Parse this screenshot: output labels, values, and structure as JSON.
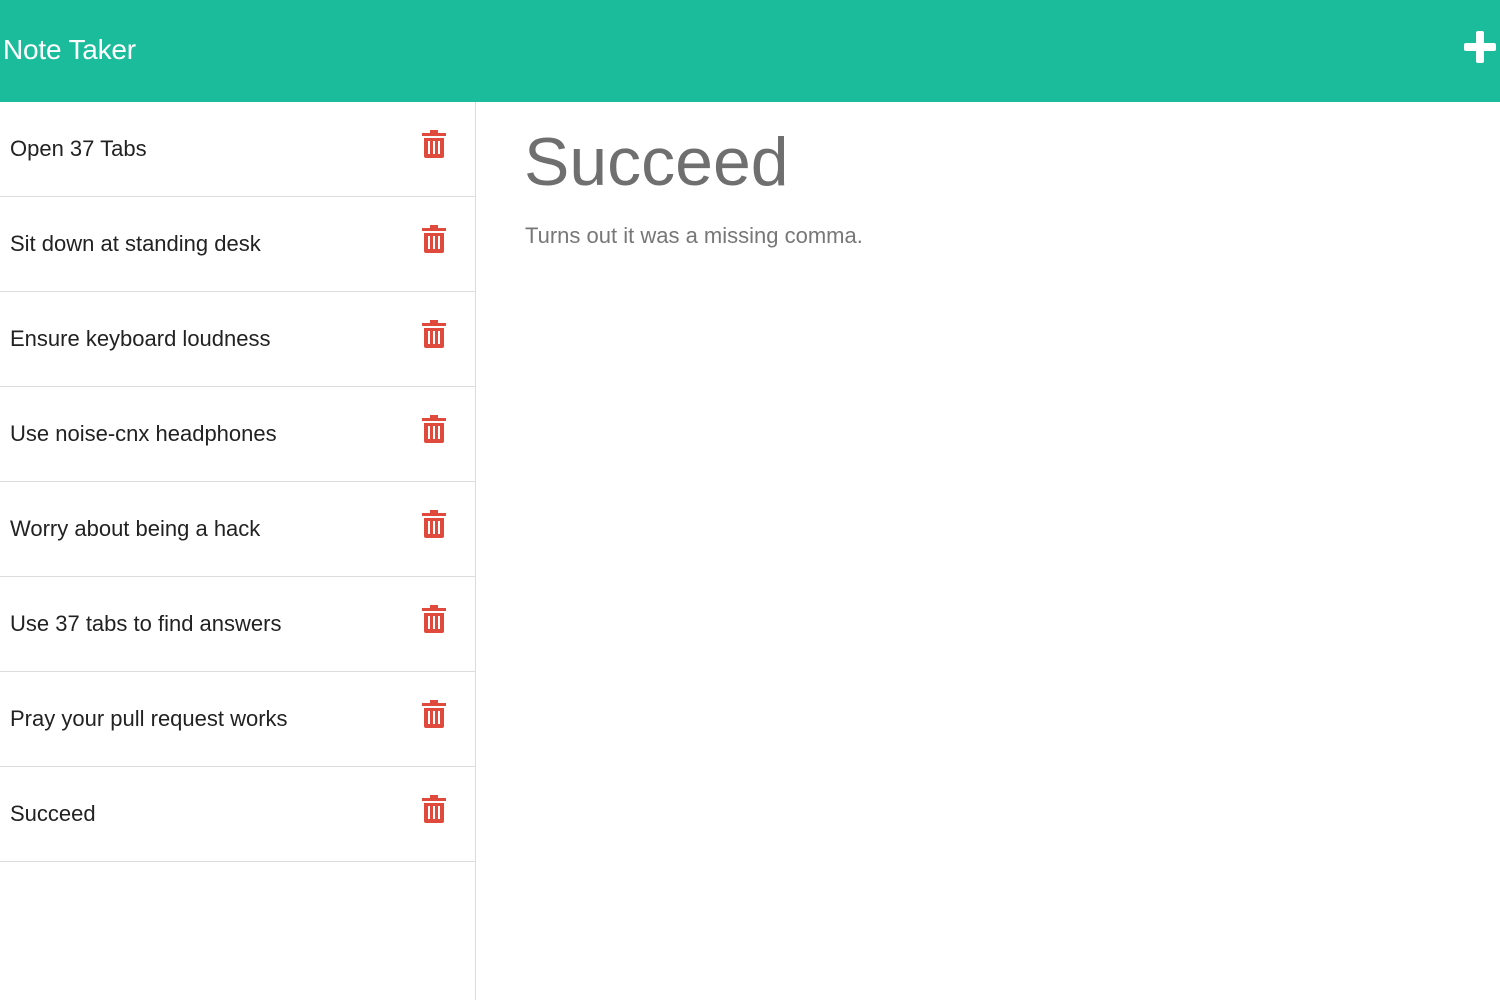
{
  "header": {
    "brand": "Note Taker",
    "add_icon": "plus-icon",
    "background_color": "#1abc9c"
  },
  "notes": [
    {
      "title": "Open 37 Tabs",
      "icon": "trash-icon"
    },
    {
      "title": "Sit down at standing desk",
      "icon": "trash-icon"
    },
    {
      "title": "Ensure keyboard loudness",
      "icon": "trash-icon"
    },
    {
      "title": "Use noise-cnx headphones",
      "icon": "trash-icon"
    },
    {
      "title": "Worry about being a hack",
      "icon": "trash-icon"
    },
    {
      "title": "Use 37 tabs to find answers",
      "icon": "trash-icon"
    },
    {
      "title": "Pray your pull request works",
      "icon": "trash-icon"
    },
    {
      "title": "Succeed",
      "icon": "trash-icon"
    }
  ],
  "active_note": {
    "title": "Succeed",
    "text": "Turns out it was a missing comma."
  },
  "colors": {
    "trash": "#e04a3c",
    "title_text": "#6f6f6f",
    "body_text": "#777777"
  }
}
